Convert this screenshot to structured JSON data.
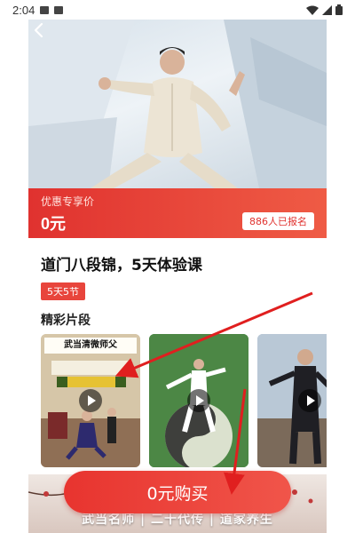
{
  "status_bar": {
    "time": "2:04"
  },
  "hero": {},
  "price_banner": {
    "promo_label": "优惠专享价",
    "price": "0元",
    "enrolled": "886人已报名"
  },
  "course": {
    "title": "道门八段锦，5天体验课",
    "tag": "5天5节"
  },
  "clips": {
    "section_title": "精彩片段",
    "items": [
      {
        "banner": "武当清微师父",
        "caption": ""
      },
      {
        "banner": "",
        "caption": ""
      },
      {
        "banner": "",
        "caption": ""
      }
    ]
  },
  "footer": {
    "buy_label": "0元购买",
    "slogan": "武当名师 | 二十代传 | 道家养生"
  },
  "colors": {
    "accent": "#e8342f",
    "banner_start": "#e0322f",
    "banner_end": "#ef5b45"
  }
}
